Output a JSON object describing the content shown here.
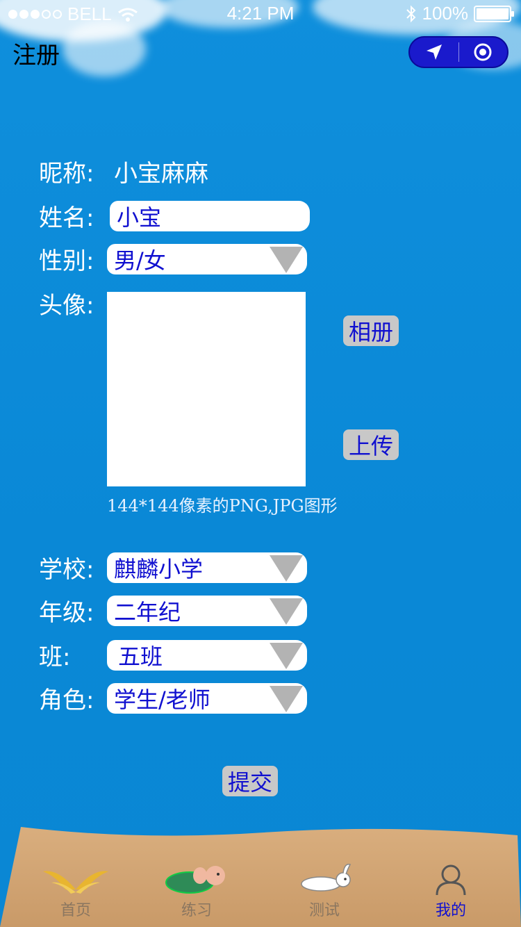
{
  "status_bar": {
    "carrier": "BELL",
    "time": "4:21 PM",
    "battery": "100%"
  },
  "nav": {
    "title": "注册",
    "capsule_icons": [
      "location-arrow-icon",
      "target-circle-icon"
    ]
  },
  "form": {
    "nickname": {
      "label": "昵称:",
      "value": "小宝麻麻"
    },
    "name": {
      "label": "姓名:",
      "value": "小宝"
    },
    "gender": {
      "label": "性别:",
      "value": "男/女"
    },
    "avatar": {
      "label": "头像:",
      "album_button": "相册",
      "upload_button": "上传",
      "hint": "144*144像素的PNG,JPG图形"
    },
    "school": {
      "label": "学校:",
      "value": "麒麟小学"
    },
    "grade": {
      "label": "年级:",
      "value": "二年纪"
    },
    "class": {
      "label": "班:",
      "value": "五班"
    },
    "role": {
      "label": "角色:",
      "value": "学生/老师"
    },
    "submit_button": "提交"
  },
  "tabbar": {
    "items": [
      {
        "label": "首页",
        "icon": "wings-icon",
        "active": false
      },
      {
        "label": "练习",
        "icon": "turtle-icon",
        "active": false
      },
      {
        "label": "测试",
        "icon": "rabbit-icon",
        "active": false
      },
      {
        "label": "我的",
        "icon": "user-icon",
        "active": true
      }
    ]
  },
  "colors": {
    "background": "#0b8ad8",
    "accent_text": "#1010d0",
    "capsule": "#1a1acc",
    "sand": "#d6ab7a"
  }
}
